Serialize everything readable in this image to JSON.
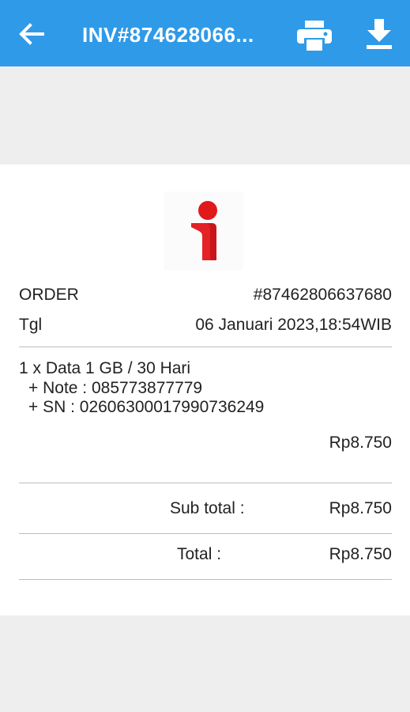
{
  "appbar": {
    "title": "INV#874628066...",
    "background": "#2f9ae8",
    "back_icon": "arrow-left-icon",
    "print_icon": "printer-icon",
    "download_icon": "download-icon"
  },
  "receipt": {
    "logo": "red-i-logo",
    "order_label": "ORDER",
    "order_value": "#87462806637680",
    "date_label": "Tgl",
    "date_value": "06 Januari 2023,18:54WIB",
    "item_line": "1 x Data 1 GB / 30 Hari",
    "note_line": "+ Note : 085773877779",
    "sn_line": "+ SN : 02606300017990736249",
    "item_price": "Rp8.750",
    "subtotal_label": "Sub total :",
    "subtotal_value": "Rp8.750",
    "total_label": "Total :",
    "total_value": "Rp8.750"
  }
}
